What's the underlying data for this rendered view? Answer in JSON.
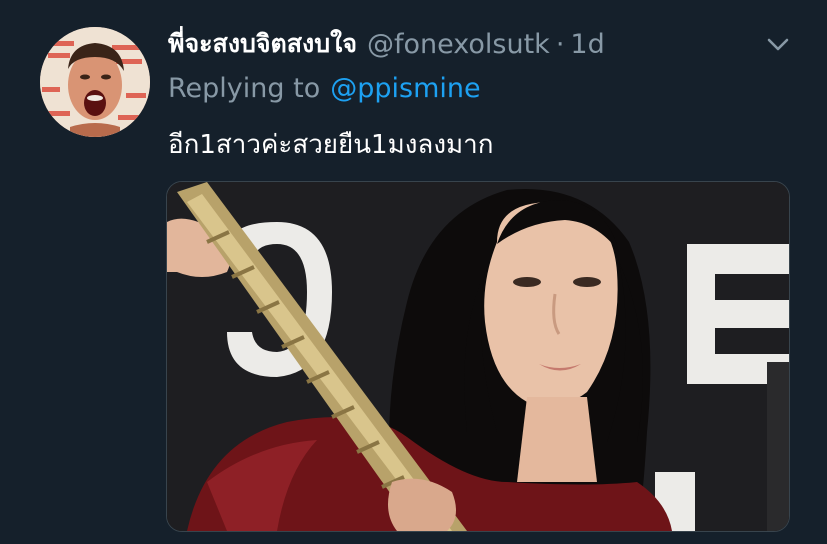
{
  "tweet": {
    "display_name": "พี่จะสงบจิตสงบใจ",
    "handle": "@fonexolsutk",
    "separator": "·",
    "timestamp": "1d",
    "reply_prefix": "Replying to",
    "reply_mention": "@ppismine",
    "text": "อีก1สาวค่ะสวยยืน1มงลงมาก"
  },
  "icons": {
    "more": "chevron-down-icon"
  },
  "colors": {
    "background": "#15202b",
    "secondary_text": "#8899a6",
    "link": "#1da1f2",
    "primary_text": "#ffffff"
  }
}
